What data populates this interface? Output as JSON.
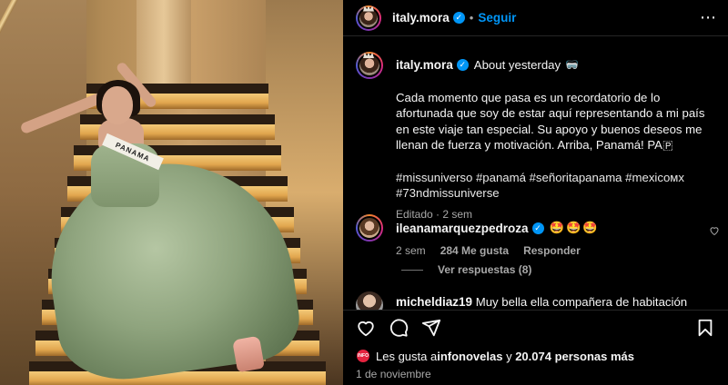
{
  "post": {
    "username": "italy.mora",
    "follow_label": "Seguir",
    "more_label": "⋯"
  },
  "caption": {
    "username": "italy.mora",
    "title": "About yesterday",
    "title_emoji": "🥽",
    "text": "Cada momento que pasa es un recordatorio de lo afortunada que soy de estar aquí representando a mi país en este viaje tan especial. Su apoyo y buenos deseos me llenan de fuerza y motivación. Arriba, Panamá! PA🇵",
    "hashtags": "#missuniverso #panamá #señoritapanama #mexicoмx #73ndmissuniverse",
    "meta": "Editado · 2 sem"
  },
  "comments": [
    {
      "username": "ileanamarquezpedroza",
      "text": "🤩🤩🤩",
      "age": "2 sem",
      "likes": "284 Me gusta",
      "reply_label": "Responder",
      "replies_label": "Ver respuestas (8)"
    },
    {
      "username": "micheldiaz19",
      "text": "Muy bella ella compañera de habitación de"
    }
  ],
  "photo": {
    "sash_text": "PANAMA"
  },
  "likes_line": {
    "prefix": "Les gusta a ",
    "first_user": "infonovelas",
    "middle": " y ",
    "count": "20.074 personas más",
    "avatar_label": "INFO"
  },
  "date": "1 de noviembre",
  "colors": {
    "background": "#000000",
    "accent": "#0095f6",
    "muted": "#a8a8a8"
  },
  "icons": [
    "verified-badge-icon",
    "more-options-icon",
    "heart-icon",
    "comment-icon",
    "share-icon",
    "bookmark-icon"
  ]
}
